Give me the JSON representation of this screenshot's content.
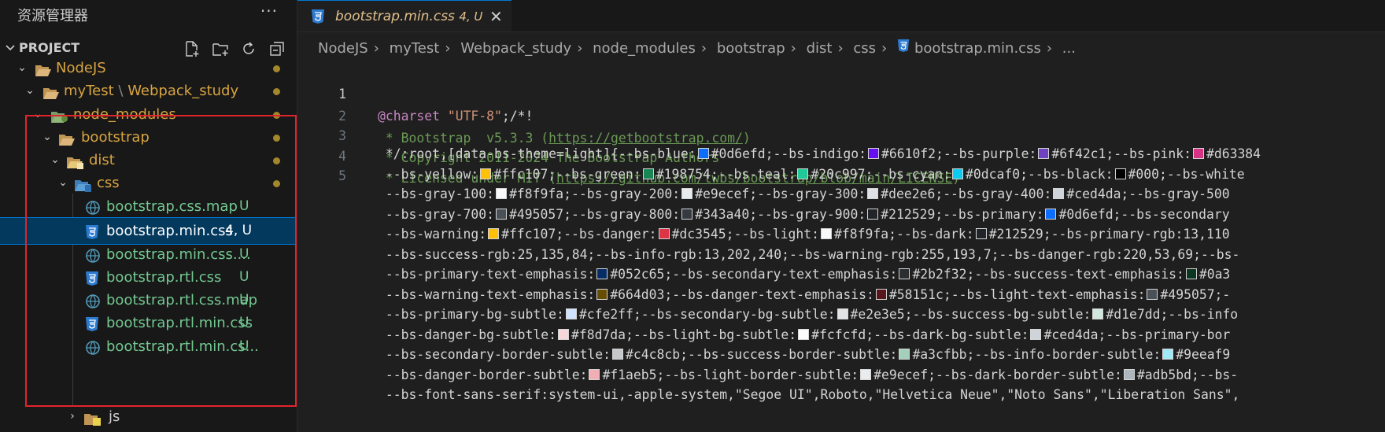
{
  "sidebar": {
    "title": "资源管理器",
    "more": "···",
    "project": "PROJECT",
    "actions": [
      "new-file-icon",
      "new-folder-icon",
      "refresh-icon",
      "collapse-all-icon"
    ],
    "items": [
      {
        "name": "NodeJS",
        "kind": "folder",
        "status": "dot"
      },
      {
        "name": "myTest",
        "sep": "\\",
        "name2": "Webpack_study",
        "kind": "folder",
        "status": "dot"
      },
      {
        "name": "node_modules",
        "kind": "folder-special",
        "status": "dot"
      },
      {
        "name": "bootstrap",
        "kind": "folder",
        "status": "dot"
      },
      {
        "name": "dist",
        "kind": "folder-special",
        "status": "dot"
      },
      {
        "name": "css",
        "kind": "folder-css",
        "status": "dot"
      },
      {
        "name": "bootstrap.css.map",
        "kind": "map",
        "badge": "U"
      },
      {
        "name": "bootstrap.min.css",
        "kind": "css",
        "badge": "4, U"
      },
      {
        "name": "bootstrap.min.css....",
        "kind": "map",
        "badge": "U"
      },
      {
        "name": "bootstrap.rtl.css",
        "kind": "css",
        "badge": "U"
      },
      {
        "name": "bootstrap.rtl.css.map",
        "kind": "map",
        "badge": "U"
      },
      {
        "name": "bootstrap.rtl.min.css",
        "kind": "css",
        "badge": "U"
      },
      {
        "name": "bootstrap.rtl.min.cs...",
        "kind": "map",
        "badge": "U"
      },
      {
        "name": "js",
        "kind": "folder-js"
      }
    ]
  },
  "tab": {
    "name": "bootstrap.min.css",
    "problems": "4, U",
    "close": "✕"
  },
  "breadcrumb": [
    "NodeJS",
    "myTest",
    "Webpack_study",
    "node_modules",
    "bootstrap",
    "dist",
    "css",
    "bootstrap.min.css",
    "..."
  ],
  "code": {
    "line_numbers": [
      "1",
      "2",
      "3",
      "4",
      "5"
    ],
    "line1": {
      "at": "@charset",
      "str": "\"UTF-8\"",
      "rest": ";/*!"
    },
    "line2": {
      "pre": " * Bootstrap  v5.3.3 (",
      "link": "https://getbootstrap.com/",
      "post": ")"
    },
    "line3": " * Copyright 2011-2024 The Bootstrap Authors",
    "line4": {
      "pre": " * Licensed under MIT (",
      "link": "https://github.com/twbs/bootstrap/blob/main/LICENSE",
      "post": ")"
    },
    "wrapped": [
      [
        {
          "t": " */:root,[data-bs-theme=light]{--bs-blue:"
        },
        {
          "c": "#0d6efd"
        },
        {
          "t": "#0d6efd;--bs-indigo:"
        },
        {
          "c": "#6610f2"
        },
        {
          "t": "#6610f2;--bs-purple:"
        },
        {
          "c": "#6f42c1"
        },
        {
          "t": "#6f42c1;--bs-pink:"
        },
        {
          "c": "#d63384"
        },
        {
          "t": "#d63384"
        }
      ],
      [
        {
          "t": " --bs-yellow:"
        },
        {
          "c": "#ffc107"
        },
        {
          "t": "#ffc107;--bs-green:"
        },
        {
          "c": "#198754"
        },
        {
          "t": "#198754;--bs-teal:"
        },
        {
          "c": "#20c997"
        },
        {
          "t": "#20c997;--bs-cyan:"
        },
        {
          "c": "#0dcaf0"
        },
        {
          "t": "#0dcaf0;--bs-black:"
        },
        {
          "c": "#000000"
        },
        {
          "t": "#000;--bs-white"
        }
      ],
      [
        {
          "t": " --bs-gray-100:"
        },
        {
          "c": "#f8f9fa"
        },
        {
          "t": "#f8f9fa;--bs-gray-200:"
        },
        {
          "c": "#e9ecef"
        },
        {
          "t": "#e9ecef;--bs-gray-300:"
        },
        {
          "c": "#dee2e6"
        },
        {
          "t": "#dee2e6;--bs-gray-400:"
        },
        {
          "c": "#ced4da"
        },
        {
          "t": "#ced4da;--bs-gray-500"
        }
      ],
      [
        {
          "t": " --bs-gray-700:"
        },
        {
          "c": "#495057"
        },
        {
          "t": "#495057;--bs-gray-800:"
        },
        {
          "c": "#343a40"
        },
        {
          "t": "#343a40;--bs-gray-900:"
        },
        {
          "c": "#212529"
        },
        {
          "t": "#212529;--bs-primary:"
        },
        {
          "c": "#0d6efd"
        },
        {
          "t": "#0d6efd;--bs-secondary"
        }
      ],
      [
        {
          "t": " --bs-warning:"
        },
        {
          "c": "#ffc107"
        },
        {
          "t": "#ffc107;--bs-danger:"
        },
        {
          "c": "#dc3545"
        },
        {
          "t": "#dc3545;--bs-light:"
        },
        {
          "c": "#f8f9fa"
        },
        {
          "t": "#f8f9fa;--bs-dark:"
        },
        {
          "c": "#212529"
        },
        {
          "t": "#212529;--bs-primary-rgb:13,110"
        }
      ],
      [
        {
          "t": " --bs-success-rgb:25,135,84;--bs-info-rgb:13,202,240;--bs-warning-rgb:255,193,7;--bs-danger-rgb:220,53,69;--bs-"
        }
      ],
      [
        {
          "t": " --bs-primary-text-emphasis:"
        },
        {
          "c": "#052c65"
        },
        {
          "t": "#052c65;--bs-secondary-text-emphasis:"
        },
        {
          "c": "#2b2f32"
        },
        {
          "t": "#2b2f32;--bs-success-text-emphasis:"
        },
        {
          "c": "#0a3622"
        },
        {
          "t": "#0a3"
        }
      ],
      [
        {
          "t": " --bs-warning-text-emphasis:"
        },
        {
          "c": "#664d03"
        },
        {
          "t": "#664d03;--bs-danger-text-emphasis:"
        },
        {
          "c": "#58151c"
        },
        {
          "t": "#58151c;--bs-light-text-emphasis:"
        },
        {
          "c": "#495057"
        },
        {
          "t": "#495057;-"
        }
      ],
      [
        {
          "t": " --bs-primary-bg-subtle:"
        },
        {
          "c": "#cfe2ff"
        },
        {
          "t": "#cfe2ff;--bs-secondary-bg-subtle:"
        },
        {
          "c": "#e2e3e5"
        },
        {
          "t": "#e2e3e5;--bs-success-bg-subtle:"
        },
        {
          "c": "#d1e7dd"
        },
        {
          "t": "#d1e7dd;--bs-info"
        }
      ],
      [
        {
          "t": " --bs-danger-bg-subtle:"
        },
        {
          "c": "#f8d7da"
        },
        {
          "t": "#f8d7da;--bs-light-bg-subtle:"
        },
        {
          "c": "#fcfcfd"
        },
        {
          "t": "#fcfcfd;--bs-dark-bg-subtle:"
        },
        {
          "c": "#ced4da"
        },
        {
          "t": "#ced4da;--bs-primary-bor"
        }
      ],
      [
        {
          "t": " --bs-secondary-border-subtle:"
        },
        {
          "c": "#c4c8cb"
        },
        {
          "t": "#c4c8cb;--bs-success-border-subtle:"
        },
        {
          "c": "#a3cfbb"
        },
        {
          "t": "#a3cfbb;--bs-info-border-subtle:"
        },
        {
          "c": "#9eeaf9"
        },
        {
          "t": "#9eeaf9"
        }
      ],
      [
        {
          "t": " --bs-danger-border-subtle:"
        },
        {
          "c": "#f1aeb5"
        },
        {
          "t": "#f1aeb5;--bs-light-border-subtle:"
        },
        {
          "c": "#e9ecef"
        },
        {
          "t": "#e9ecef;--bs-dark-border-subtle:"
        },
        {
          "c": "#adb5bd"
        },
        {
          "t": "#adb5bd;--bs-"
        }
      ],
      [
        {
          "t": " --bs-font-sans-serif:system-ui,-apple-system,\"Segoe UI\",Roboto,\"Helvetica Neue\",\"Noto Sans\",\"Liberation Sans\","
        }
      ]
    ]
  },
  "colors": {
    "accent": "#0078d4",
    "highlight_box": "#e0242b",
    "untracked": "#73c991",
    "modified": "#d7a441"
  }
}
